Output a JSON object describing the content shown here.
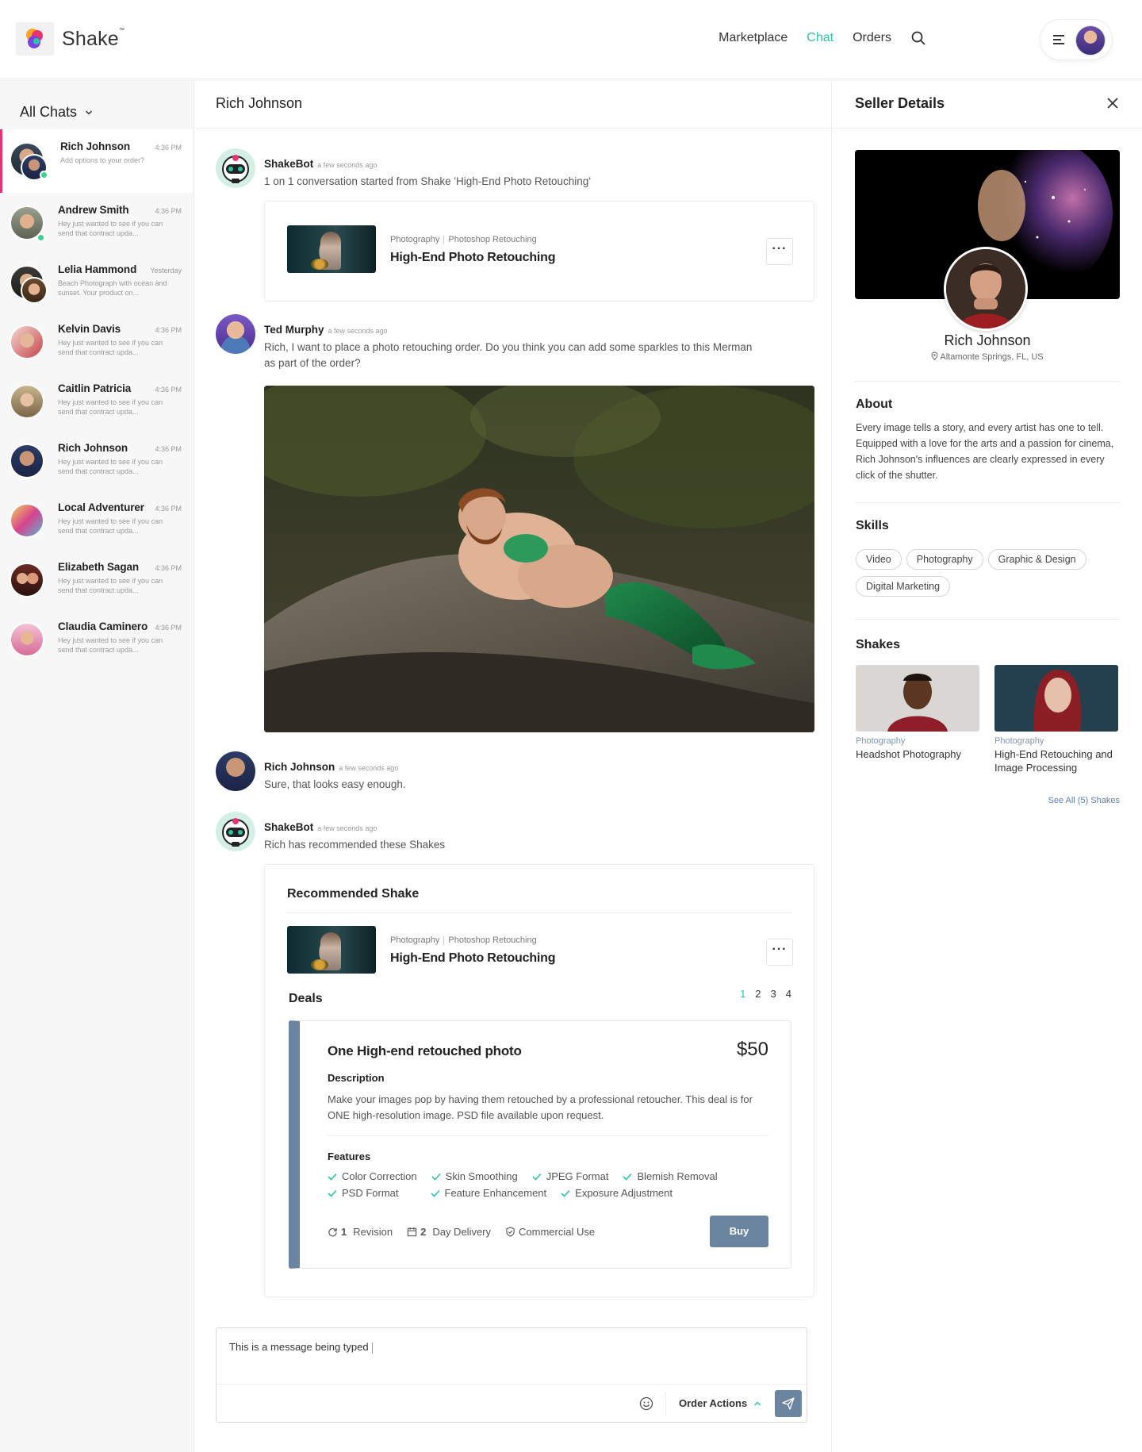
{
  "header": {
    "brand": "Shake",
    "brand_tm": "™",
    "nav": [
      {
        "label": "Marketplace",
        "active": false
      },
      {
        "label": "Chat",
        "active": true
      },
      {
        "label": "Orders",
        "active": false
      }
    ],
    "accent_color": "#2ec4a3"
  },
  "sidebar": {
    "title": "All Chats",
    "chats": [
      {
        "name": "Rich Johnson",
        "time": "4:36 PM",
        "preview": "Add options to your order?",
        "active": true,
        "online": true
      },
      {
        "name": "Andrew Smith",
        "time": "4:36 PM",
        "preview": "Hey just wanted to see if you can send that contract upda...",
        "active": false,
        "online": true
      },
      {
        "name": "Lelia Hammond",
        "time": "Yesterday",
        "preview": "Beach Photograph with ocean and sunset. Your product on...",
        "active": false,
        "online": false
      },
      {
        "name": "Kelvin Davis",
        "time": "4:36 PM",
        "preview": "Hey just wanted to see if you can send that contract upda...",
        "active": false,
        "online": false
      },
      {
        "name": "Caitlin Patricia",
        "time": "4:36 PM",
        "preview": "Hey just wanted to see if you can send that contract upda...",
        "active": false,
        "online": false
      },
      {
        "name": "Rich Johnson",
        "time": "4:36 PM",
        "preview": "Hey just wanted to see if you can send that contract upda...",
        "active": false,
        "online": false
      },
      {
        "name": "Local Adventurer",
        "time": "4:36 PM",
        "preview": "Hey just wanted to see if you can send that contract upda...",
        "active": false,
        "online": false
      },
      {
        "name": "Elizabeth Sagan",
        "time": "4:36 PM",
        "preview": "Hey just wanted to see if you can send that contract upda...",
        "active": false,
        "online": false
      },
      {
        "name": "Claudia Caminero",
        "time": "4:36 PM",
        "preview": "Hey just wanted to see if you can send that contract upda...",
        "active": false,
        "online": false
      }
    ],
    "active_color": "#e8336d"
  },
  "conversation": {
    "title": "Rich Johnson",
    "messages": [
      {
        "sender": "ShakeBot",
        "time": "a few seconds ago",
        "text": "1 on 1 conversation started from Shake 'High-End Photo Retouching'"
      },
      {
        "sender": "Ted Murphy",
        "time": "a few seconds ago",
        "text": "Rich, I want to place a photo retouching order. Do you think you can add some sparkles to this Merman as part of the order?"
      },
      {
        "sender": "Rich Johnson",
        "time": "a few seconds ago",
        "text": "Sure, that looks easy enough."
      },
      {
        "sender": "ShakeBot",
        "time": "a few seconds ago",
        "text": "Rich has recommended these Shakes"
      }
    ],
    "shake": {
      "category": "Photography",
      "subcategory": "Photoshop Retouching",
      "title": "High-End Photo Retouching",
      "more": "···"
    },
    "recommended": {
      "heading": "Recommended Shake",
      "deals_label": "Deals",
      "pages": [
        "1",
        "2",
        "3",
        "4"
      ],
      "current_page": "1",
      "deal": {
        "title": "One High-end retouched photo",
        "price": "$50",
        "description_heading": "Description",
        "description": "Make your images pop by having them retouched by a professional retoucher. This deal is for ONE high-resolution image. PSD file available upon request.",
        "features_heading": "Features",
        "features": [
          "Color Correction",
          "Skin Smoothing",
          "JPEG Format",
          "Blemish Removal",
          "PSD Format",
          "Feature Enhancement",
          "Exposure Adjustment"
        ],
        "revision_count": "1",
        "revision_label": "Revision",
        "delivery_count": "2",
        "delivery_label": "Day Delivery",
        "license": "Commercial Use",
        "buy_label": "Buy",
        "accent_color": "#6b84a0"
      }
    },
    "composer": {
      "value": "This is a message being typed",
      "order_actions": "Order Actions"
    }
  },
  "seller": {
    "heading": "Seller Details",
    "name": "Rich Johnson",
    "location": "Altamonte Springs, FL, US",
    "about_heading": "About",
    "about": "Every image tells a story, and every artist has one to tell. Equipped with a love for the arts and a passion for cinema, Rich Johnson's influences are clearly expressed in every click of the shutter.",
    "skills_heading": "Skills",
    "skills": [
      "Video",
      "Photography",
      "Graphic & Design",
      "Digital Marketing"
    ],
    "shakes_heading": "Shakes",
    "shakes": [
      {
        "category": "Photography",
        "title": "Headshot Photography"
      },
      {
        "category": "Photography",
        "title": "High-End Retouching and Image Processing"
      }
    ],
    "see_all": "See All (5) Shakes"
  }
}
